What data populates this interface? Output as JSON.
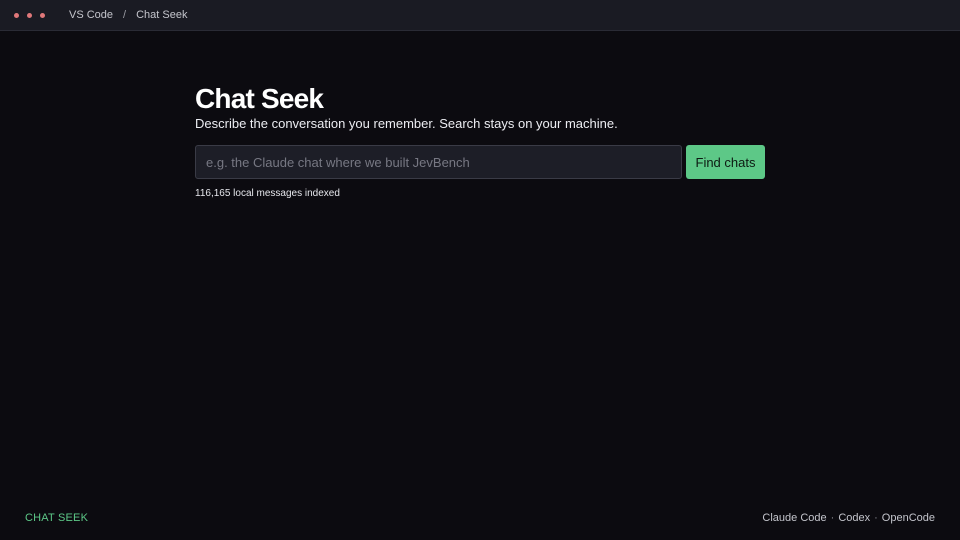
{
  "titlebar": {
    "window_dot_color": "#e0787a",
    "breadcrumb": [
      "VS Code",
      "Chat Seek"
    ],
    "separator": "/"
  },
  "main": {
    "title": "Chat Seek",
    "subtitle": "Describe the conversation you remember. Search stays on your machine.",
    "search": {
      "value": "",
      "placeholder": "e.g. the Claude chat where we built JevBench"
    },
    "find_button_label": "Find chats",
    "index_status": "116,165 local messages indexed"
  },
  "footer": {
    "brand": "CHAT SEEK",
    "agents": [
      "Claude Code",
      "Codex",
      "OpenCode"
    ],
    "agent_separator": "·"
  },
  "colors": {
    "background": "#0c0b10",
    "titlebar": "#1a1b23",
    "accent": "#5dc887",
    "input_bg": "#1d1e27"
  }
}
